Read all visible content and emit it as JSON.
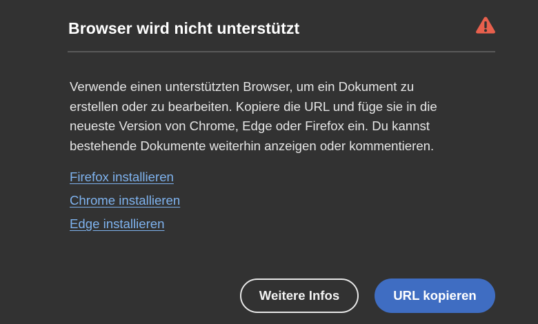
{
  "dialog": {
    "title": "Browser wird nicht unterstützt",
    "alert_icon": "alert-triangle-icon",
    "alert_color": "#e34850",
    "body_lines": [
      "Verwende einen unterstützten Browser, um ein Dokument zu",
      "erstellen oder zu bearbeiten. Kopiere die URL und füge sie in die",
      "neueste Version von Chrome, Edge oder Firefox ein. Du kannst",
      "bestehende Dokumente weiterhin anzeigen oder kommentieren."
    ],
    "links": {
      "firefox": "Firefox installieren",
      "chrome": "Chrome installieren",
      "edge": "Edge installieren"
    },
    "link_color": "#7fb3ef",
    "buttons": {
      "more_info": "Weitere Infos",
      "copy_url": "URL kopieren"
    },
    "primary_color": "#3f6dc2"
  }
}
